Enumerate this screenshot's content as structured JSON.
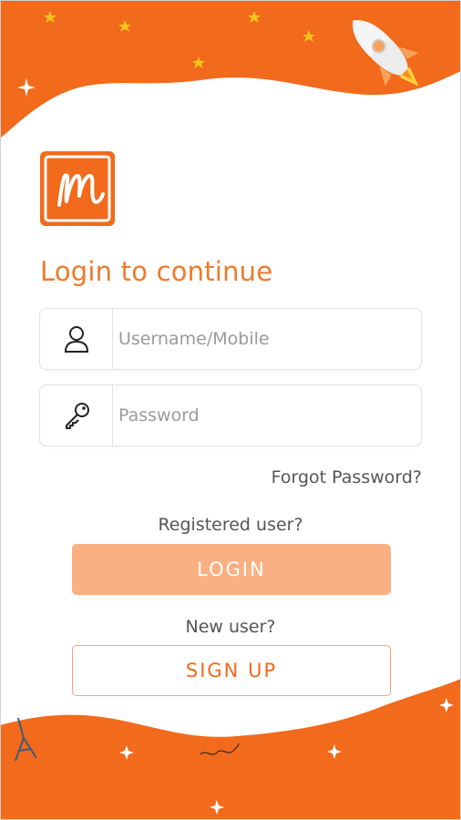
{
  "title": "Login to continue",
  "username": {
    "placeholder": "Username/Mobile",
    "icon": "user-icon"
  },
  "password": {
    "placeholder": "Password",
    "icon": "key-icon"
  },
  "forgot_password": "Forgot Password?",
  "registered_prompt": "Registered user?",
  "login_label": "LOGIN",
  "new_user_prompt": "New user?",
  "signup_label": "SIGN UP",
  "colors": {
    "accent": "#f26a1b",
    "login_button": "#fbb083",
    "title": "#f07a2a"
  }
}
